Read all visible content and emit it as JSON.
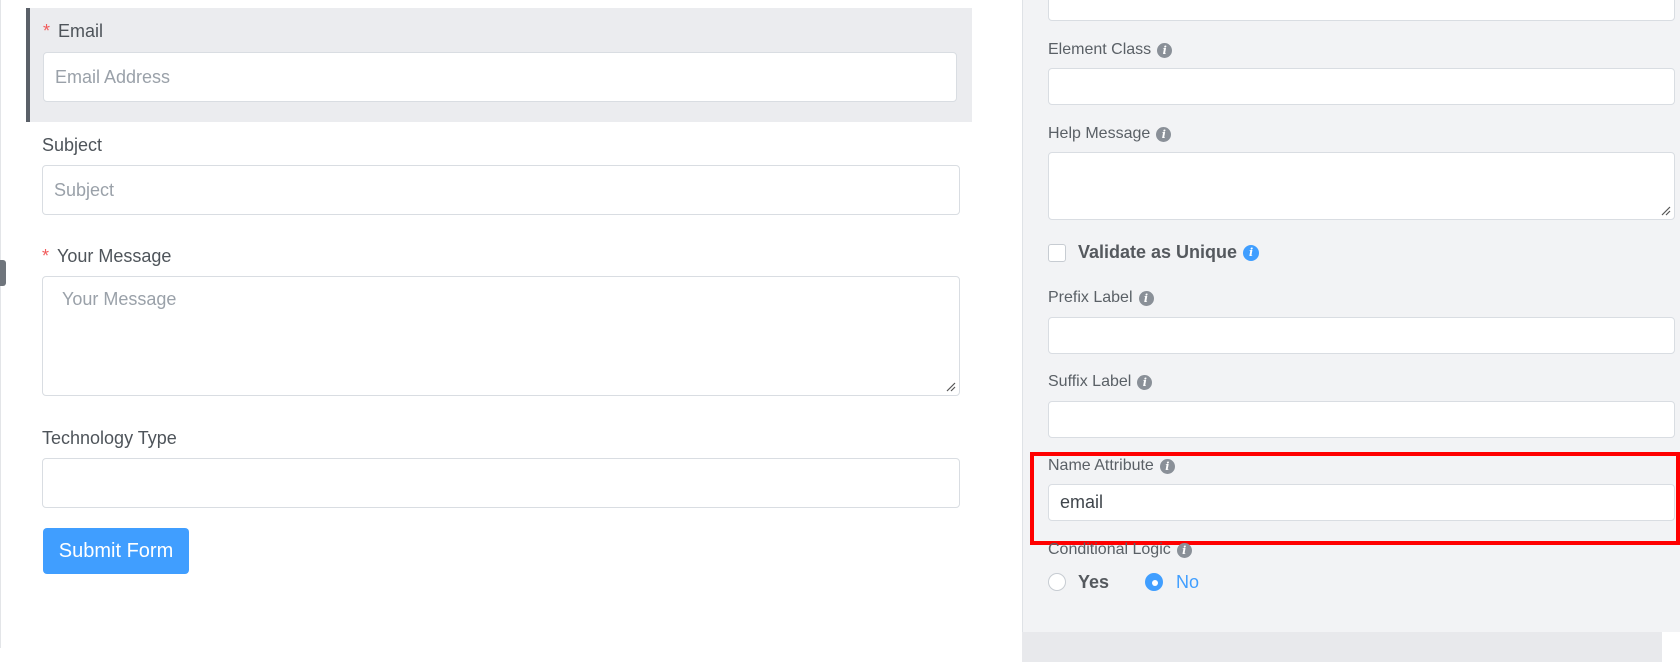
{
  "form": {
    "email": {
      "label": "Email",
      "required_mark": "*",
      "placeholder": "Email Address"
    },
    "subject": {
      "label": "Subject",
      "placeholder": "Subject"
    },
    "message": {
      "label": "Your Message",
      "required_mark": "*",
      "placeholder": "Your Message"
    },
    "technology": {
      "label": "Technology Type",
      "value": ""
    },
    "submit_label": "Submit Form"
  },
  "settings": {
    "top_input_value": "",
    "element_class": {
      "label": "Element Class",
      "value": ""
    },
    "help_message": {
      "label": "Help Message",
      "value": ""
    },
    "validate_unique": {
      "label": "Validate as Unique",
      "checked": false
    },
    "prefix_label": {
      "label": "Prefix Label",
      "value": ""
    },
    "suffix_label": {
      "label": "Suffix Label",
      "value": ""
    },
    "name_attribute": {
      "label": "Name Attribute",
      "value": "email"
    },
    "conditional_logic": {
      "label": "Conditional Logic",
      "options": [
        "Yes",
        "No"
      ],
      "selected": "No"
    }
  },
  "icons": {
    "info": "info-icon",
    "info_glyph": "i"
  },
  "colors": {
    "accent": "#409eff",
    "required": "#f15b5b",
    "highlight": "#ff0000"
  }
}
